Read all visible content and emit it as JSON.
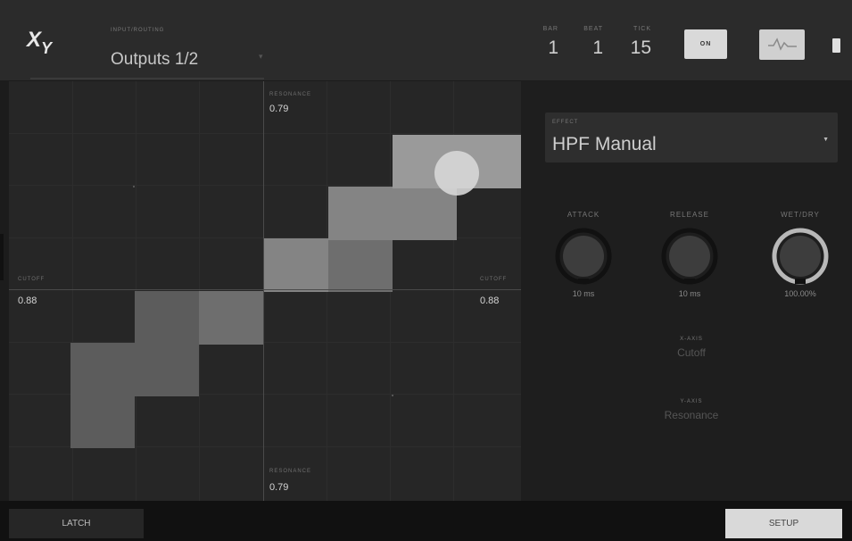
{
  "header": {
    "logo_text": "XY",
    "output_caption": "INPUT/ROUTING",
    "output_value": "Outputs 1/2",
    "bar_caption": "BAR",
    "bar_value": "1",
    "beat_caption": "BEAT",
    "beat_value": "1",
    "tick_caption": "TICK",
    "tick_value": "15",
    "on_label": "ON",
    "wave_icon": "waveform-icon",
    "battery_icon": "battery-icon"
  },
  "pad": {
    "top_caption": "RESONANCE",
    "top_value": "0.79",
    "bottom_caption": "RESONANCE",
    "bottom_value": "0.79",
    "left_caption": "CUTOFF",
    "left_value": "0.88",
    "right_caption": "CUTOFF",
    "right_value": "0.88"
  },
  "effect": {
    "caption": "EFFECT",
    "value": "HPF Manual"
  },
  "knobs": {
    "attack_label": "ATTACK",
    "attack_value": "10 ms",
    "release_label": "RELEASE",
    "release_value": "10 ms",
    "wetdry_label": "WET/DRY",
    "wetdry_value": "100.00%",
    "wetdry_level": 1.0
  },
  "params": {
    "x_caption": "X-AXIS",
    "x_value": "Cutoff",
    "y_caption": "Y-AXIS",
    "y_value": "Resonance"
  },
  "footer": {
    "latch_label": "LATCH",
    "setup_label": "SETUP"
  },
  "colors": {
    "background": "#1c1c1c",
    "panel": "#262626",
    "accent_light": "#d9d9d9"
  }
}
